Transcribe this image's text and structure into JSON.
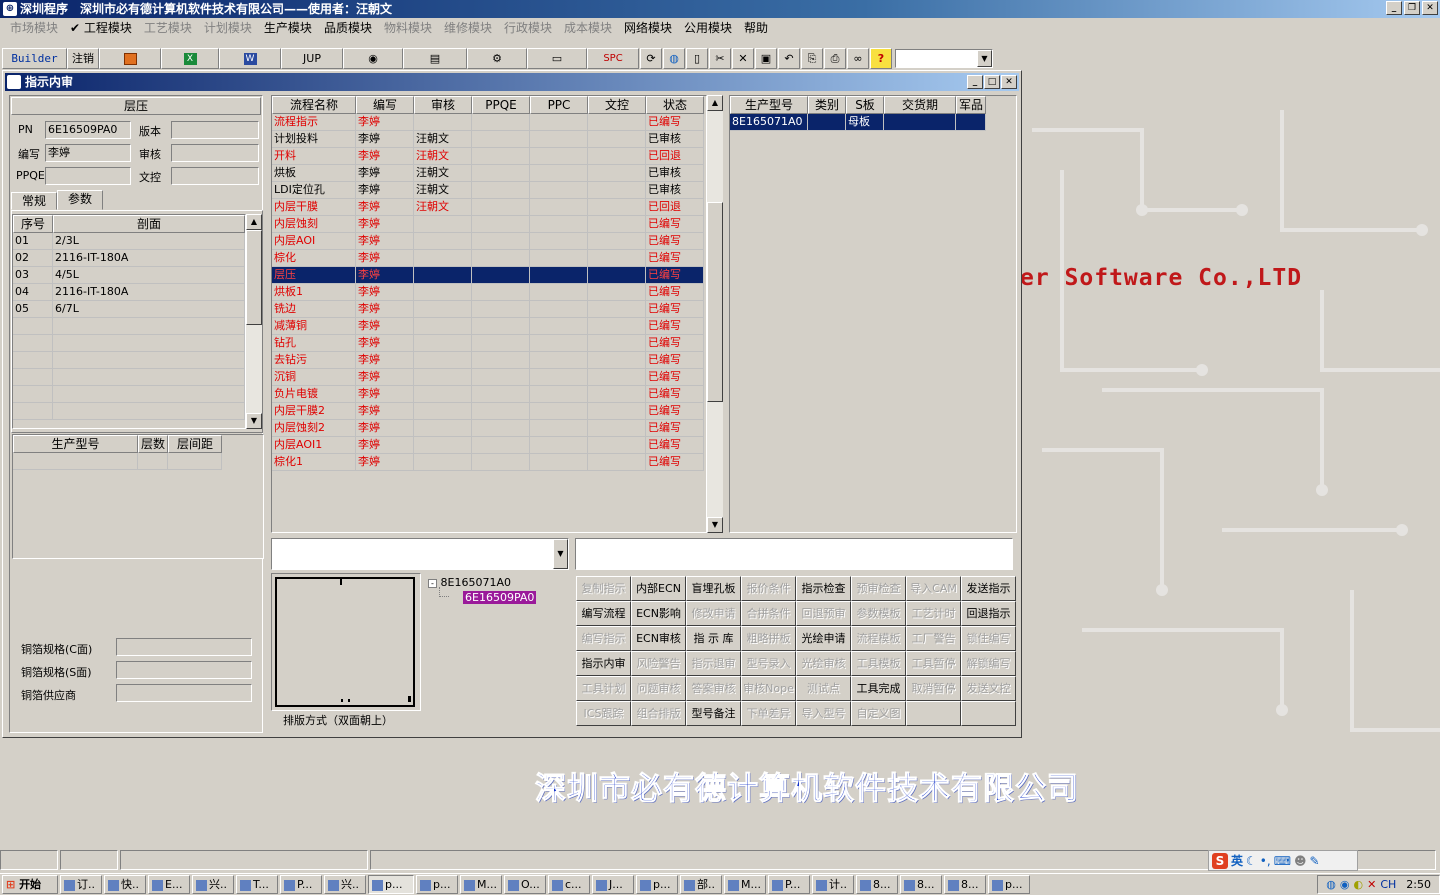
{
  "app": {
    "title": "深圳程序　深圳市必有德计算机软件技术有限公司——使用者：汪朝文"
  },
  "menu": [
    {
      "label": "市场模块",
      "enabled": false
    },
    {
      "label": "✔ 工程模块",
      "enabled": true
    },
    {
      "label": "工艺模块",
      "enabled": false
    },
    {
      "label": "计划模块",
      "enabled": false
    },
    {
      "label": "生产模块",
      "enabled": true
    },
    {
      "label": "品质模块",
      "enabled": true
    },
    {
      "label": "物料模块",
      "enabled": false
    },
    {
      "label": "维修模块",
      "enabled": false
    },
    {
      "label": "行政模块",
      "enabled": false
    },
    {
      "label": "成本模块",
      "enabled": false
    },
    {
      "label": "网络模块",
      "enabled": true
    },
    {
      "label": "公用模块",
      "enabled": true
    },
    {
      "label": "帮助",
      "enabled": true
    }
  ],
  "toolbar": {
    "builder": "Builder",
    "logout": "注销",
    "jup": "JUP",
    "spc": "SPC"
  },
  "child": {
    "title": "指示内审"
  },
  "left": {
    "header": "层压",
    "pn_label": "PN",
    "pn_value": "6E16509PA0",
    "version_label": "版本",
    "version_value": "",
    "author_label": "编写",
    "author_value": "李婷",
    "review_label": "审核",
    "review_value": "",
    "ppqe_label": "PPQE",
    "ppqe_value": "",
    "control_label": "文控",
    "control_value": "",
    "tab_general": "常规",
    "tab_params": "参数",
    "layer_cols": [
      "序号",
      "剖面"
    ],
    "layers": [
      [
        "01",
        "2/3L"
      ],
      [
        "02",
        "2116-IT-180A"
      ],
      [
        "03",
        "4/5L"
      ],
      [
        "04",
        "2116-IT-180A"
      ],
      [
        "05",
        "6/7L"
      ]
    ],
    "prod_cols": [
      "生产型号",
      "层数",
      "层间距"
    ],
    "copper_c_label": "铜箔规格(C面)",
    "copper_s_label": "铜箔规格(S面)",
    "copper_vendor_label": "铜箔供应商"
  },
  "flow": {
    "cols": [
      "流程名称",
      "编写",
      "审核",
      "PPQE",
      "PPC",
      "文控",
      "状态"
    ],
    "rows": [
      {
        "name": "流程指示",
        "author": "李婷",
        "reviewer": "",
        "status": "已编写",
        "red": true
      },
      {
        "name": "计划投料",
        "author": "李婷",
        "reviewer": "汪朝文",
        "status": "已审核",
        "red": false
      },
      {
        "name": "开料",
        "author": "李婷",
        "reviewer": "汪朝文",
        "status": "已回退",
        "red": true
      },
      {
        "name": "烘板",
        "author": "李婷",
        "reviewer": "汪朝文",
        "status": "已审核",
        "red": false
      },
      {
        "name": "LDI定位孔",
        "author": "李婷",
        "reviewer": "汪朝文",
        "status": "已审核",
        "red": false
      },
      {
        "name": "内层干膜",
        "author": "李婷",
        "reviewer": "汪朝文",
        "status": "已回退",
        "red": true
      },
      {
        "name": "内层蚀刻",
        "author": "李婷",
        "reviewer": "",
        "status": "已编写",
        "red": true
      },
      {
        "name": "内层AOI",
        "author": "李婷",
        "reviewer": "",
        "status": "已编写",
        "red": true
      },
      {
        "name": "棕化",
        "author": "李婷",
        "reviewer": "",
        "status": "已编写",
        "red": true
      },
      {
        "name": "层压",
        "author": "李婷",
        "reviewer": "",
        "status": "已编写",
        "red": true,
        "selected": true
      },
      {
        "name": "烘板1",
        "author": "李婷",
        "reviewer": "",
        "status": "已编写",
        "red": true
      },
      {
        "name": "铣边",
        "author": "李婷",
        "reviewer": "",
        "status": "已编写",
        "red": true
      },
      {
        "name": "减薄铜",
        "author": "李婷",
        "reviewer": "",
        "status": "已编写",
        "red": true
      },
      {
        "name": "钻孔",
        "author": "李婷",
        "reviewer": "",
        "status": "已编写",
        "red": true
      },
      {
        "name": "去钻污",
        "author": "李婷",
        "reviewer": "",
        "status": "已编写",
        "red": true
      },
      {
        "name": "沉铜",
        "author": "李婷",
        "reviewer": "",
        "status": "已编写",
        "red": true
      },
      {
        "name": "负片电镀",
        "author": "李婷",
        "reviewer": "",
        "status": "已编写",
        "red": true
      },
      {
        "name": "内层干膜2",
        "author": "李婷",
        "reviewer": "",
        "status": "已编写",
        "red": true
      },
      {
        "name": "内层蚀刻2",
        "author": "李婷",
        "reviewer": "",
        "status": "已编写",
        "red": true
      },
      {
        "name": "内层AOI1",
        "author": "李婷",
        "reviewer": "",
        "status": "已编写",
        "red": true
      },
      {
        "name": "棕化1",
        "author": "李婷",
        "reviewer": "",
        "status": "已编写",
        "red": true
      }
    ]
  },
  "model": {
    "cols": [
      "生产型号",
      "类别",
      "S板",
      "交货期",
      "军品"
    ],
    "rows": [
      [
        "8E165071A0",
        "",
        "母板",
        "",
        ""
      ]
    ]
  },
  "tree": {
    "root": "8E165071A0",
    "child": "6E16509PA0"
  },
  "panel_caption": "排版方式（双面朝上）",
  "buttons": [
    {
      "label": "复制指示",
      "enabled": false
    },
    {
      "label": "内部ECN",
      "enabled": true
    },
    {
      "label": "盲埋孔板",
      "enabled": true
    },
    {
      "label": "报价条件",
      "enabled": false
    },
    {
      "label": "指示检查",
      "enabled": true
    },
    {
      "label": "预审检查",
      "enabled": false
    },
    {
      "label": "导入CAM",
      "enabled": false
    },
    {
      "label": "发送指示",
      "enabled": true
    },
    {
      "label": "编写流程",
      "enabled": true
    },
    {
      "label": "ECN影响",
      "enabled": true
    },
    {
      "label": "修改申请",
      "enabled": false
    },
    {
      "label": "合拼条件",
      "enabled": false
    },
    {
      "label": "回退预审",
      "enabled": false
    },
    {
      "label": "参数模板",
      "enabled": false
    },
    {
      "label": "工艺计时",
      "enabled": false
    },
    {
      "label": "回退指示",
      "enabled": true
    },
    {
      "label": "编写指示",
      "enabled": false
    },
    {
      "label": "ECN审核",
      "enabled": true
    },
    {
      "label": "指 示 库",
      "enabled": true
    },
    {
      "label": "粗略拼板",
      "enabled": false
    },
    {
      "label": "光绘申请",
      "enabled": true
    },
    {
      "label": "流程模板",
      "enabled": false
    },
    {
      "label": "工厂警告",
      "enabled": false
    },
    {
      "label": "锁住编写",
      "enabled": false
    },
    {
      "label": "指示内审",
      "enabled": true
    },
    {
      "label": "风险警告",
      "enabled": false
    },
    {
      "label": "指示退审",
      "enabled": false
    },
    {
      "label": "型号录入",
      "enabled": false
    },
    {
      "label": "光绘审核",
      "enabled": false
    },
    {
      "label": "工具模板",
      "enabled": false
    },
    {
      "label": "工具暂停",
      "enabled": false
    },
    {
      "label": "解锁编写",
      "enabled": false
    },
    {
      "label": "工具计划",
      "enabled": false
    },
    {
      "label": "问题审核",
      "enabled": false
    },
    {
      "label": "答案审核",
      "enabled": false
    },
    {
      "label": "审核Nope",
      "enabled": false
    },
    {
      "label": "测试点",
      "enabled": false
    },
    {
      "label": "工具完成",
      "enabled": true
    },
    {
      "label": "取消暂停",
      "enabled": false
    },
    {
      "label": "发送文控",
      "enabled": false
    },
    {
      "label": "ICS跟踪",
      "enabled": false
    },
    {
      "label": "组合排版",
      "enabled": false
    },
    {
      "label": "型号备注",
      "enabled": true
    },
    {
      "label": "下单差异",
      "enabled": false
    },
    {
      "label": "导入型号",
      "enabled": false
    },
    {
      "label": "自定义图",
      "enabled": false
    },
    {
      "label": "",
      "enabled": false
    },
    {
      "label": "",
      "enabled": false
    }
  ],
  "background": {
    "software": "er Software Co.,LTD",
    "company": "深圳市必有德计算机软件技术有限公司"
  },
  "taskbar": {
    "start": "开始",
    "items": [
      "订..",
      "快..",
      "E...",
      "兴..",
      "T...",
      "P...",
      "兴..",
      "p...",
      "p...",
      "M...",
      "O...",
      "c...",
      "J...",
      "p...",
      "部..",
      "M...",
      "P...",
      "计..",
      "8...",
      "8...",
      "8...",
      "p..."
    ],
    "clock": "2:50"
  },
  "ime": {
    "lang": "英"
  },
  "colors": {
    "title_start": "#0a246a",
    "title_end": "#a6caf0",
    "selection": "#0a246a",
    "status_red": "#e00000",
    "company_blue": "#1030c8",
    "software_red": "#c0181a"
  }
}
